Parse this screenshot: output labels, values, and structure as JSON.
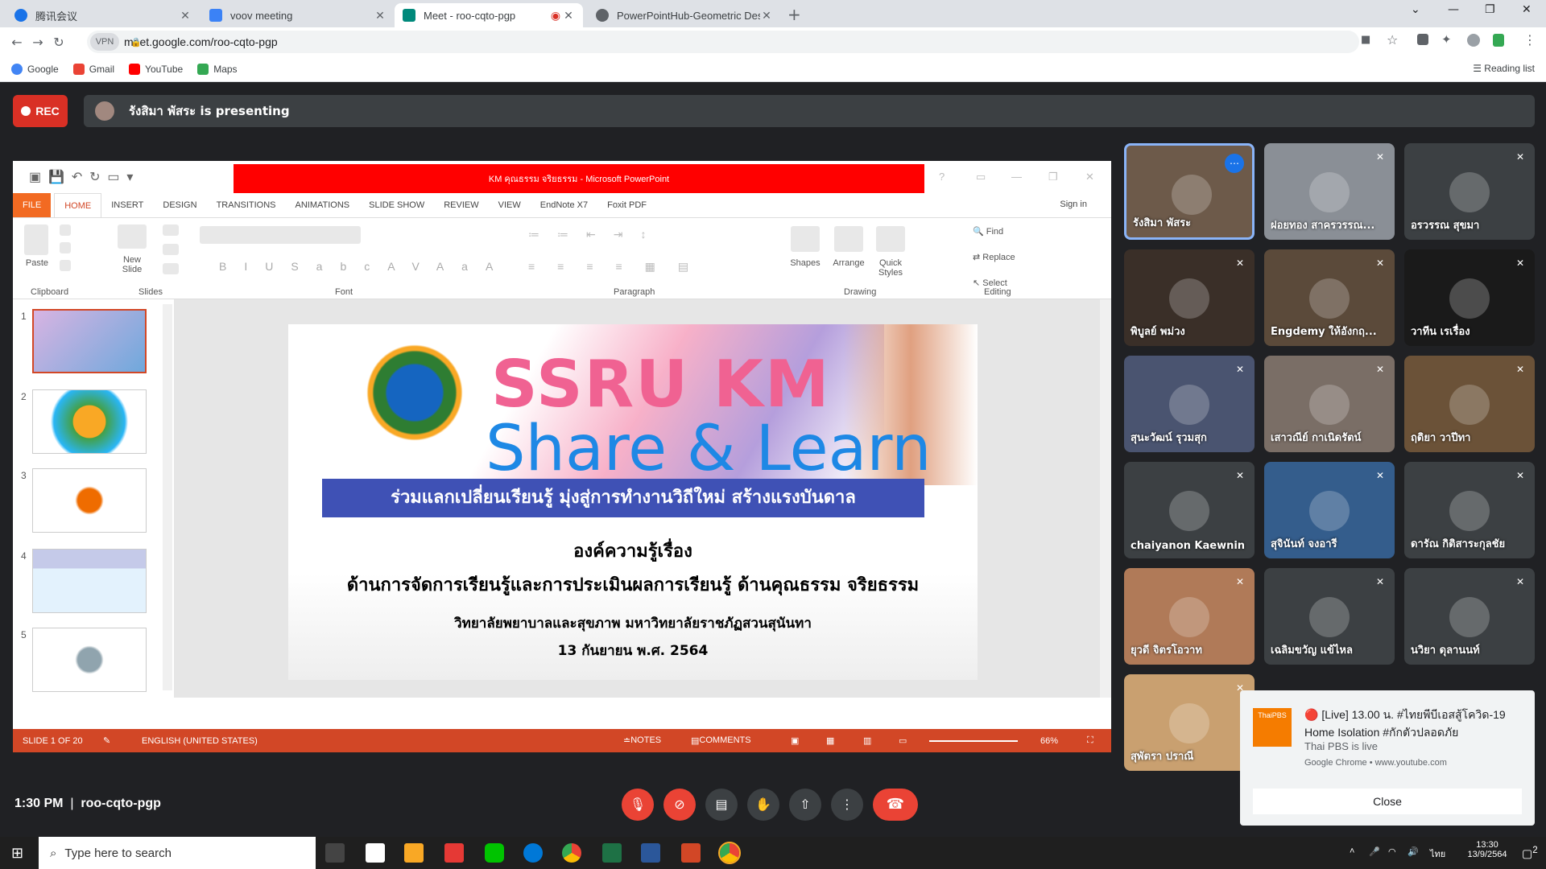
{
  "browser": {
    "tabs": [
      {
        "title": "腾讯会议",
        "favicon": "#1a73e8"
      },
      {
        "title": "voov meeting",
        "favicon": "#3b82f6"
      },
      {
        "title": "Meet - roo-cqto-pgp",
        "favicon": "#00897b"
      },
      {
        "title": "PowerPointHub-Geometric Desig",
        "favicon": "#5f6368"
      }
    ],
    "url": "meet.google.com/roo-cqto-pgp",
    "vpn_label": "VPN",
    "bookmarks": [
      "Google",
      "Gmail",
      "YouTube",
      "Maps"
    ],
    "reading_list": "Reading list"
  },
  "meet": {
    "rec_label": "REC",
    "presenter_text": "รังสิมา พัสระ is presenting",
    "time": "1:30 PM",
    "meeting_code": "roo-cqto-pgp"
  },
  "ppt": {
    "window_title": "KM คุณธรรม จริยธรรม - Microsoft PowerPoint",
    "tabs": [
      "FILE",
      "HOME",
      "INSERT",
      "DESIGN",
      "TRANSITIONS",
      "ANIMATIONS",
      "SLIDE SHOW",
      "REVIEW",
      "VIEW",
      "EndNote X7",
      "Foxit PDF"
    ],
    "sign_in": "Sign in",
    "groups": [
      "Clipboard",
      "Slides",
      "Font",
      "Paragraph",
      "Drawing",
      "Editing"
    ],
    "buttons": {
      "paste": "Paste",
      "new_slide": "New Slide",
      "shapes": "Shapes",
      "arrange": "Arrange",
      "quick_styles": "Quick Styles",
      "find": "Find",
      "replace": "Replace",
      "select": "Select"
    },
    "slide_numbers": [
      "1",
      "2",
      "3",
      "4",
      "5"
    ],
    "status": {
      "slide": "SLIDE 1 OF 20",
      "language": "ENGLISH (UNITED STATES)",
      "notes": "NOTES",
      "comments": "COMMENTS",
      "zoom": "66%"
    }
  },
  "slide": {
    "title_line1": "SSRU KM",
    "title_line2": "Share & Learn",
    "banner": "ร่วมแลกเปลี่ยนเรียนรู้ มุ่งสู่การทำงานวิถีใหม่ สร้างแรงบันดาล",
    "heading": "องค์ความรู้เรื่อง",
    "subheading": "ด้านการจัดการเรียนรู้และการประเมินผลการเรียนรู้ ด้านคุณธรรม จริยธรรม",
    "org": "วิทยาลัยพยาบาลและสุขภาพ  มหาวิทยาลัยราชภัฏสวนสุนันทา",
    "date": "13 กันยายน พ.ศ. 2564"
  },
  "participants": [
    {
      "name": "รังสิมา พัสระ",
      "bg": "#6d5a4a"
    },
    {
      "name": "ฝอยทอง สาครวรรณ...",
      "bg": "#8a8f96"
    },
    {
      "name": "อรวรรณ สุขมา",
      "bg": "#3c4043"
    },
    {
      "name": "พิบูลย์ พม่วง",
      "bg": "#3a2f28"
    },
    {
      "name": "Engdemy ให้อังกฤ...",
      "bg": "#5b4a3a"
    },
    {
      "name": "วาทีน เรเรื่อง",
      "bg": "#1a1a1a"
    },
    {
      "name": "สุนะวัฒน์ รุวมสุก",
      "bg": "#4a5470"
    },
    {
      "name": "เสาวณีย์ กาเนิดรัตน์",
      "bg": "#7a6e66"
    },
    {
      "name": "ฤดิยา วาปีทา",
      "bg": "#6b5238"
    },
    {
      "name": "chaiyanon Kaewnin",
      "bg": "#3c4043"
    },
    {
      "name": "สุจินันท์ จงอารี",
      "bg": "#345d8c"
    },
    {
      "name": "ดารัณ กิติสาระกุลชัย",
      "bg": "#3c4043"
    },
    {
      "name": "ยุวดี จิตรโอวาท",
      "bg": "#b07a58"
    },
    {
      "name": "เฉลิมขวัญ แข้ไหล",
      "bg": "#3c4043"
    },
    {
      "name": "นวิยา ดุลานนท์",
      "bg": "#3c4043"
    },
    {
      "name": "สุพัตรา ปราณี",
      "bg": "#c9a070"
    }
  ],
  "notification": {
    "title": "🔴 [Live] 13.00 น. #ไทยพีบีเอสสู้โควิด-19 Home Isolation #กักตัวปลอดภัย",
    "channel": "Thai PBS is live",
    "source": "Google Chrome • www.youtube.com",
    "close": "Close",
    "logo": "ThaiPBS"
  },
  "taskbar": {
    "search_placeholder": "Type here to search",
    "time": "13:30",
    "date": "13/9/2564",
    "lang": "ไทย",
    "badge": "2"
  }
}
